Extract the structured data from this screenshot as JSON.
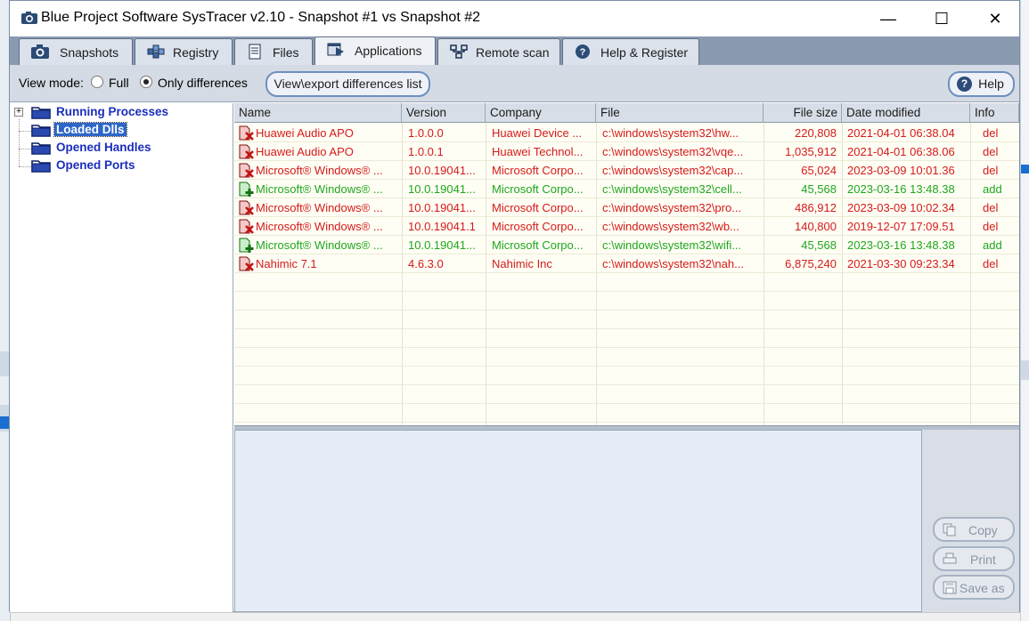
{
  "window": {
    "title": "Blue Project Software SysTracer v2.10 - Snapshot #1 vs Snapshot #2",
    "minimize_glyph": "—",
    "maximize_glyph": "☐",
    "close_glyph": "✕"
  },
  "tabs": [
    {
      "label": "Snapshots",
      "icon": "camera-icon",
      "active": false
    },
    {
      "label": "Registry",
      "icon": "registry-icon",
      "active": false
    },
    {
      "label": "Files",
      "icon": "files-icon",
      "active": false
    },
    {
      "label": "Applications",
      "icon": "applications-icon",
      "active": true
    },
    {
      "label": "Remote scan",
      "icon": "network-icon",
      "active": false
    },
    {
      "label": "Help & Register",
      "icon": "help-icon",
      "active": false
    }
  ],
  "toolbar": {
    "view_mode_label": "View mode:",
    "full_label": "Full",
    "only_diff_label": "Only differences",
    "selected_mode": "Only differences",
    "export_label": "View\\export differences list",
    "help_label": "Help"
  },
  "tree": {
    "items": [
      {
        "label": "Running Processes",
        "expandable": true,
        "selected": false
      },
      {
        "label": "Loaded Dlls",
        "expandable": false,
        "selected": true
      },
      {
        "label": "Opened Handles",
        "expandable": false,
        "selected": false
      },
      {
        "label": "Opened Ports",
        "expandable": false,
        "selected": false
      }
    ]
  },
  "list": {
    "columns": [
      "Name",
      "Version",
      "Company",
      "File",
      "File size",
      "Date modified",
      "Info"
    ],
    "rows": [
      {
        "name": "Huawei Audio APO",
        "version": "1.0.0.0",
        "company": "Huawei Device ...",
        "file": "c:\\windows\\system32\\hw...",
        "size": "220,808",
        "date": "2021-04-01 06:38.04",
        "info": "del",
        "status": "del"
      },
      {
        "name": "Huawei Audio APO",
        "version": "1.0.0.1",
        "company": "Huawei Technol...",
        "file": "c:\\windows\\system32\\vqe...",
        "size": "1,035,912",
        "date": "2021-04-01 06:38.06",
        "info": "del",
        "status": "del"
      },
      {
        "name": "Microsoft® Windows® ...",
        "version": "10.0.19041...",
        "company": "Microsoft Corpo...",
        "file": "c:\\windows\\system32\\cap...",
        "size": "65,024",
        "date": "2023-03-09 10:01.36",
        "info": "del",
        "status": "del"
      },
      {
        "name": "Microsoft® Windows® ...",
        "version": "10.0.19041...",
        "company": "Microsoft Corpo...",
        "file": "c:\\windows\\system32\\cell...",
        "size": "45,568",
        "date": "2023-03-16 13:48.38",
        "info": "add",
        "status": "add"
      },
      {
        "name": "Microsoft® Windows® ...",
        "version": "10.0.19041...",
        "company": "Microsoft Corpo...",
        "file": "c:\\windows\\system32\\pro...",
        "size": "486,912",
        "date": "2023-03-09 10:02.34",
        "info": "del",
        "status": "del"
      },
      {
        "name": "Microsoft® Windows® ...",
        "version": "10.0.19041.1",
        "company": "Microsoft Corpo...",
        "file": "c:\\windows\\system32\\wb...",
        "size": "140,800",
        "date": "2019-12-07 17:09.51",
        "info": "del",
        "status": "del"
      },
      {
        "name": "Microsoft® Windows® ...",
        "version": "10.0.19041...",
        "company": "Microsoft Corpo...",
        "file": "c:\\windows\\system32\\wifi...",
        "size": "45,568",
        "date": "2023-03-16 13:48.38",
        "info": "add",
        "status": "add"
      },
      {
        "name": "Nahimic 7.1",
        "version": "4.6.3.0",
        "company": "Nahimic Inc",
        "file": "c:\\windows\\system32\\nah...",
        "size": "6,875,240",
        "date": "2021-03-30 09:23.34",
        "info": "del",
        "status": "del"
      }
    ]
  },
  "side_buttons": {
    "copy_label": "Copy",
    "print_label": "Print",
    "save_label": "Save as"
  },
  "colors": {
    "deleted": "#d41a1a",
    "added": "#1fa61f",
    "tree_text": "#1a2ebc",
    "selection": "#2c66c8"
  }
}
